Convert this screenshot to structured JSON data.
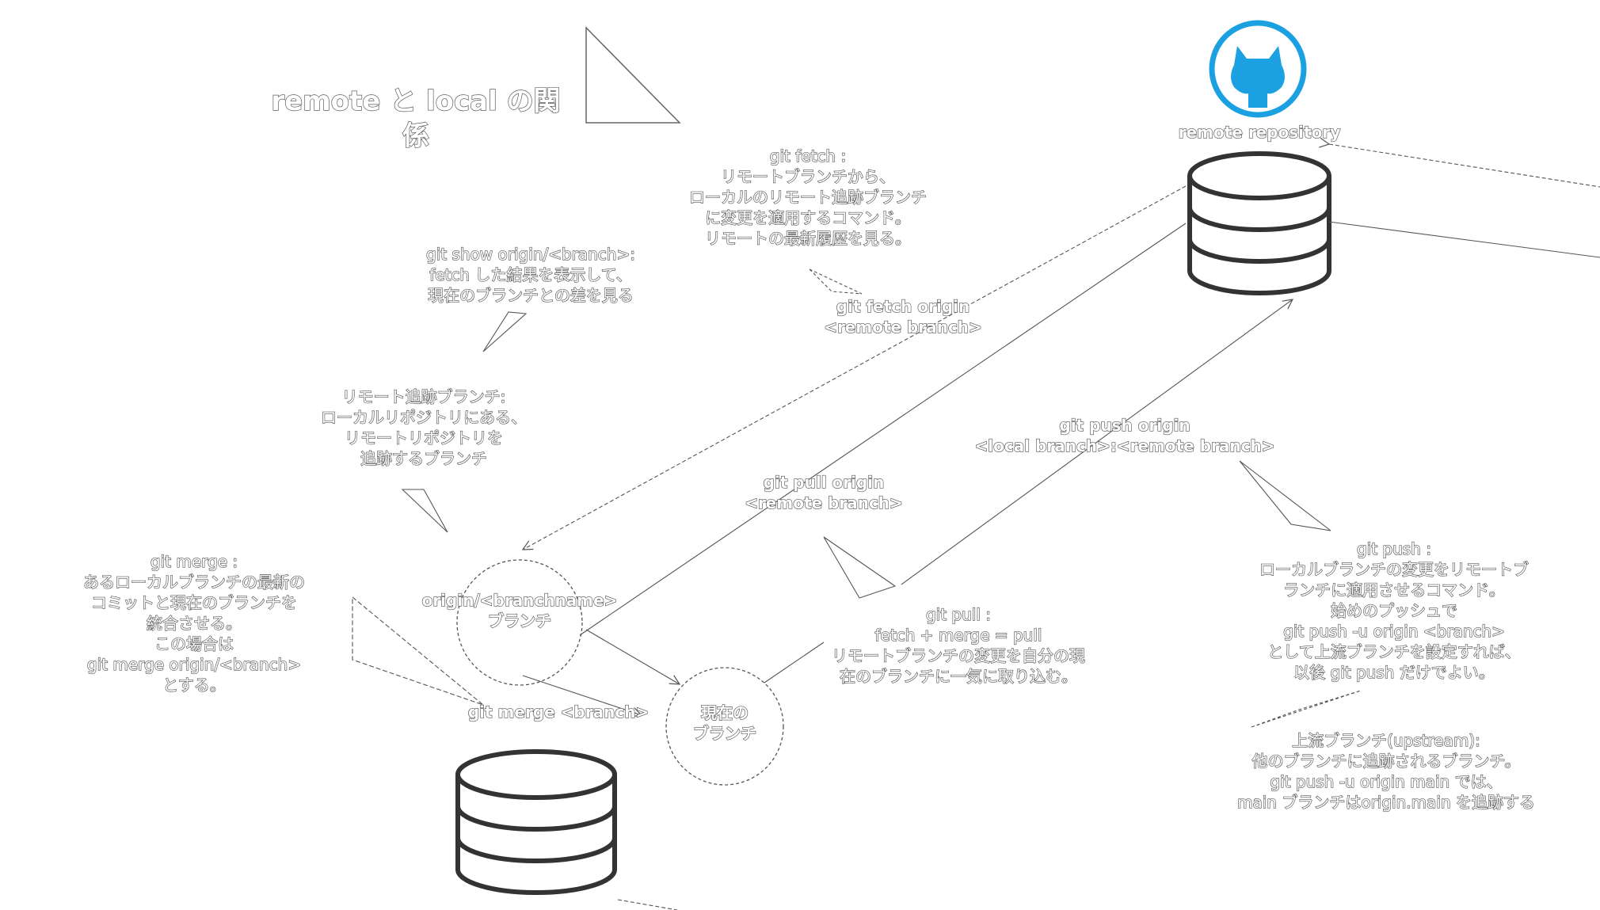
{
  "title": "remote と local の関係",
  "remote_label": "remote repository",
  "icons": {
    "remote": "github-octocat-icon",
    "database": "database-icon"
  },
  "colors": {
    "github_blue": "#1ba1e2",
    "line": "#555555",
    "db_stroke": "#333333"
  },
  "git_fetch_desc": "git fetch :\nリモートブランチから、\nローカルのリモート追跡ブランチ\nに変更を適用するコマンド。\nリモートの最新履歴を見る。",
  "git_show_desc": "git show origin/<branch>:\nfetch した結果を表示して、\n現在のブランチとの差を見る",
  "fetch_cmd": "git fetch origin\n<remote branch>",
  "tracking_desc": "リモート追跡ブランチ:\nローカルリポジトリにある、\nリモートリポジトリを\n追跡するブランチ",
  "push_cmd": "git push origin\n<local branch>:<remote branch>",
  "pull_cmd": "git pull origin\n<remote branch>",
  "merge_desc": "git merge :\nあるローカルブランチの最新の\nコミットと現在のブランチを\n統合させる。\nこの場合は\ngit merge origin/<branch>\nとする。",
  "origin_branch": "origin/<branchname>\nブランチ",
  "pull_desc": "git pull :\nfetch + merge = pull\nリモートブランチの変更を自分の現\n在のブランチに一気に取り込む。",
  "push_desc": "git push :\nローカルブランチの変更をリモートブ\nランチに適用させるコマンド。\n始めのプッシュで\ngit push -u origin <branch>\nとして上流ブランチを設定すれば、\n以後 git push だけでよい。",
  "merge_cmd": "git merge <branch>",
  "current_branch": "現在の\nブランチ",
  "upstream_desc": "上流ブランチ(upstream):\n他のブランチに追跡されるブランチ。\ngit push -u origin main では、\nmain ブランチはorigin.main を追跡する"
}
